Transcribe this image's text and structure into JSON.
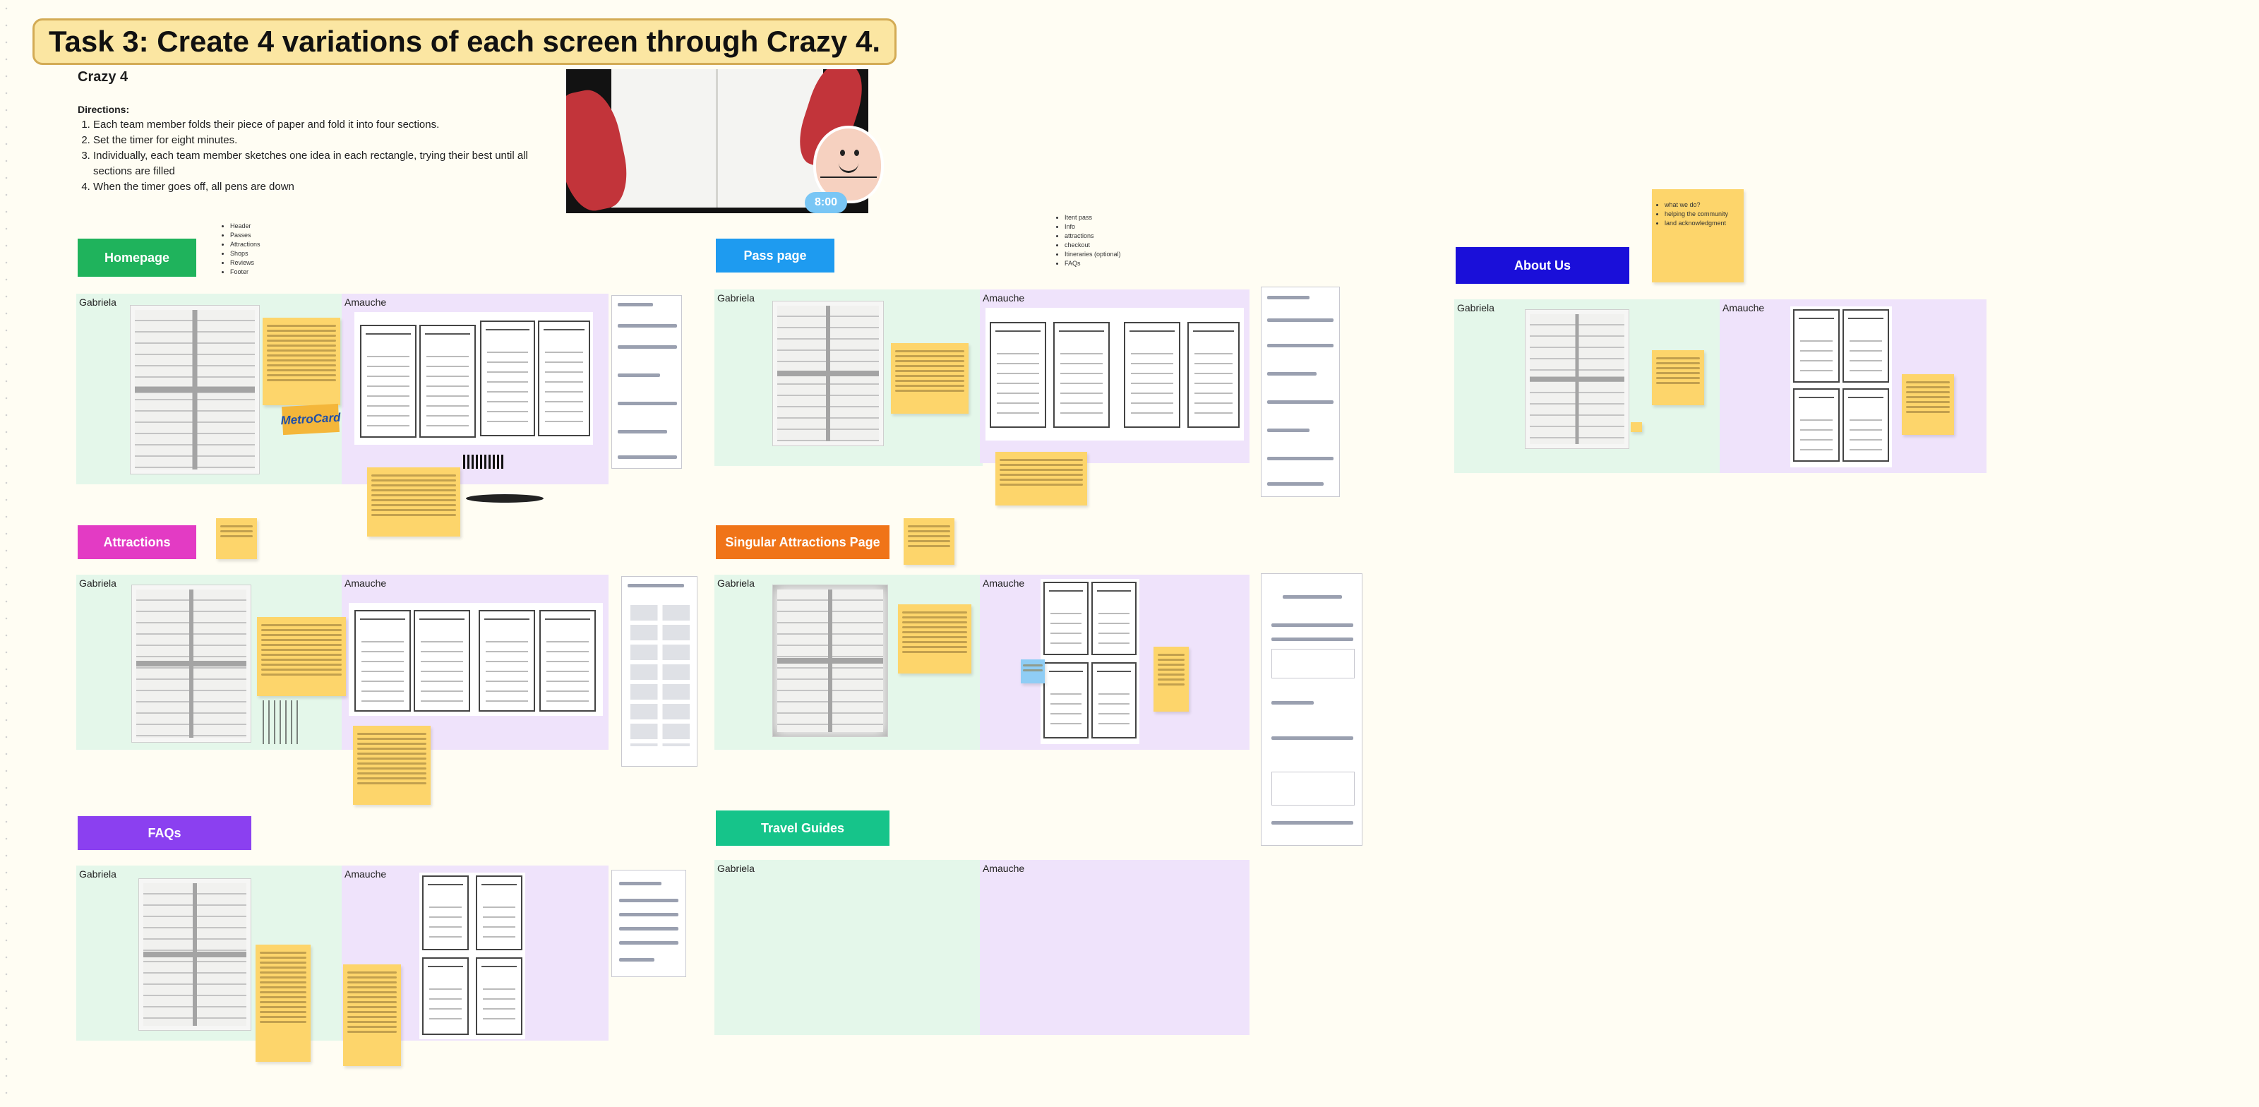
{
  "task_title": "Task 3: Create 4 variations of each screen through Crazy 4.",
  "crazy4": {
    "heading": "Crazy 4",
    "directions_label": "Directions:",
    "directions": [
      "Each team member folds their piece of paper and fold it into four sections.",
      "Set the timer for eight minutes.",
      "Individually, each team member sketches one idea in each rectangle, trying their best until all sections are filled",
      "When the timer goes off, all pens are down"
    ]
  },
  "timer": "8:00",
  "members": {
    "left": "Gabriela",
    "right": "Amauche"
  },
  "sections": {
    "homepage": {
      "label": "Homepage",
      "color": "#1fb35c",
      "bullets": [
        "Header",
        "Passes",
        "Attractions",
        "Shops",
        "Reviews",
        "Footer"
      ]
    },
    "pass_page": {
      "label": "Pass page",
      "color": "#1e9bf0",
      "bullets": [
        "Itent pass",
        "Info",
        "attractions",
        "checkout",
        "Itineraries (optional)",
        "FAQs"
      ]
    },
    "about_us": {
      "label": "About Us",
      "color": "#1a0fd9",
      "bullets": [
        "what we do?",
        "helping the community",
        "land acknowledgment"
      ]
    },
    "attractions": {
      "label": "Attractions",
      "color": "#e33bc4"
    },
    "singular_attractions": {
      "label": "Singular Attractions Page",
      "color": "#f07418"
    },
    "faqs": {
      "label": "FAQs",
      "color": "#8b40f0"
    },
    "travel_guides": {
      "label": "Travel Guides",
      "color": "#16c48a"
    }
  },
  "metrocard": "MetroCard"
}
